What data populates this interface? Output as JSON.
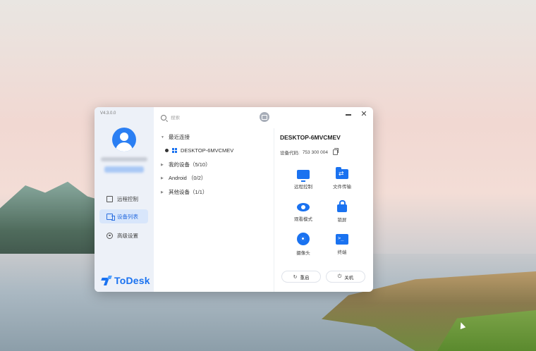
{
  "app": {
    "version": "V4.3.0.0",
    "brand_name": "ToDesk",
    "brand_color": "#1a72f0"
  },
  "sidebar": {
    "items": [
      {
        "label": "远程控制",
        "icon": "remote-control-icon",
        "active": false
      },
      {
        "label": "设备列表",
        "icon": "device-list-icon",
        "active": true
      },
      {
        "label": "高级设置",
        "icon": "advanced-settings-icon",
        "active": false
      }
    ]
  },
  "search": {
    "placeholder": "搜索"
  },
  "device_list": {
    "groups": [
      {
        "label": "最近连接",
        "expanded": true
      },
      {
        "label": "我的设备（5/10）",
        "expanded": false
      },
      {
        "label": "Android （0/2）",
        "expanded": false
      },
      {
        "label": "其他设备（1/1）",
        "expanded": false
      }
    ],
    "recent_device": "DESKTOP-6MVCMEV"
  },
  "detail": {
    "device_name": "DESKTOP-6MVCMEV",
    "code_label": "设备代码:",
    "code_value": "753 300 004",
    "actions": [
      {
        "label": "远程控制",
        "icon": "monitor-icon"
      },
      {
        "label": "文件传输",
        "icon": "folder-transfer-icon"
      },
      {
        "label": "观看模式",
        "icon": "eye-icon"
      },
      {
        "label": "锁屏",
        "icon": "lock-icon"
      },
      {
        "label": "摄像头",
        "icon": "camera-icon"
      },
      {
        "label": "终端",
        "icon": "terminal-icon"
      }
    ],
    "restart_label": "重启",
    "shutdown_label": "关机"
  },
  "window_controls": {
    "close_glyph": "✕"
  }
}
